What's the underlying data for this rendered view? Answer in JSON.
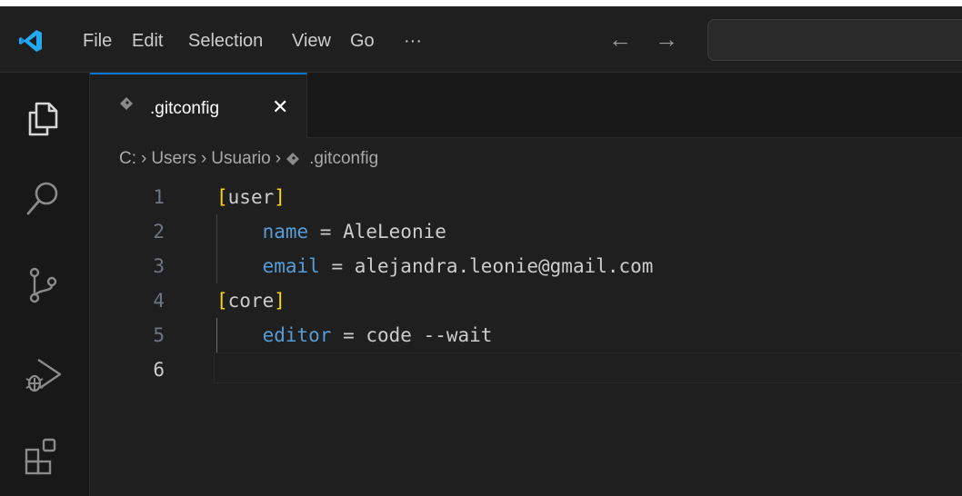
{
  "titlebar": {
    "menu": [
      "File",
      "Edit",
      "Selection",
      "View",
      "Go",
      "···"
    ],
    "back_arrow": "←",
    "forward_arrow": "→",
    "command_center_placeholder": ""
  },
  "activity_bar": {
    "items": [
      "explorer-icon",
      "search-icon",
      "source-control-icon",
      "run-debug-icon",
      "extensions-icon"
    ]
  },
  "tab": {
    "label": ".gitconfig",
    "close": "✕",
    "accent_color": "#0078d4"
  },
  "breadcrumb": [
    "C:",
    "Users",
    "Usuario",
    ".gitconfig"
  ],
  "breadcrumb_separator": "›",
  "editor": {
    "lines": [
      {
        "number": "1",
        "bracket_open": "[",
        "section": "user",
        "bracket_close": "]"
      },
      {
        "number": "2",
        "indent": "    ",
        "key": "name",
        "rest": " = AleLeonie"
      },
      {
        "number": "3",
        "indent": "    ",
        "key": "email",
        "rest": " = alejandra.leonie@gmail.com"
      },
      {
        "number": "4",
        "bracket_open": "[",
        "section": "core",
        "bracket_close": "]"
      },
      {
        "number": "5",
        "indent": "    ",
        "key": "editor",
        "rest": " = code --wait"
      },
      {
        "number": "6"
      }
    ],
    "active_line": "6"
  },
  "colors": {
    "background": "#1f1f1f",
    "bracket": "#ffd700",
    "key": "#569cd6",
    "text": "#cccccc"
  }
}
